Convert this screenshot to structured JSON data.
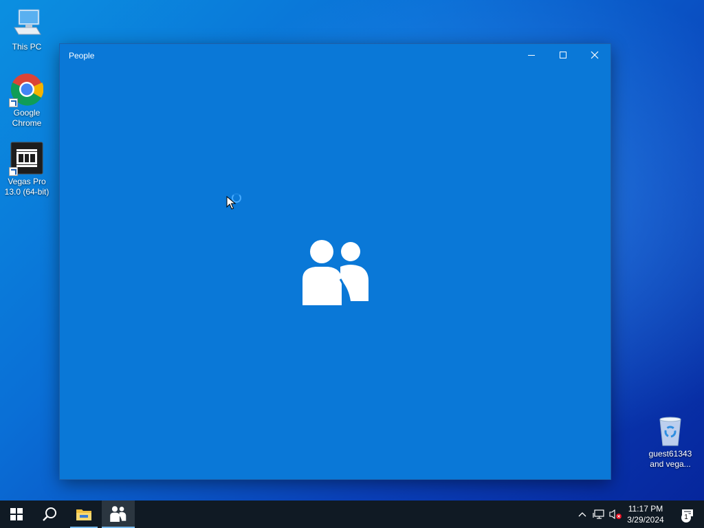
{
  "desktop": {
    "icons": [
      {
        "label": "This PC",
        "icon": "this-pc-icon"
      },
      {
        "label": "Google\nChrome",
        "icon": "chrome-icon"
      },
      {
        "label": "Vegas Pro\n13.0 (64-bit)",
        "icon": "vegas-pro-icon"
      },
      {
        "label": "guest61343\nand vega...",
        "icon": "recycle-bin-icon"
      }
    ]
  },
  "window": {
    "title": "People",
    "controls": [
      "minimize",
      "maximize",
      "close"
    ],
    "background": "#0a78d7",
    "splash_icon": "people-icon"
  },
  "taskbar": {
    "pinned": [
      {
        "name": "start",
        "icon": "windows-logo-icon"
      },
      {
        "name": "search",
        "icon": "search-icon"
      },
      {
        "name": "file-explorer",
        "icon": "folder-icon"
      },
      {
        "name": "people",
        "icon": "people-icon",
        "active": true
      }
    ],
    "tray": [
      "chevron-up-icon",
      "network-icon",
      "volume-muted-icon"
    ],
    "clock": {
      "time": "11:17 PM",
      "date": "3/29/2024"
    },
    "notifications": {
      "count": "1"
    }
  },
  "colors": {
    "accent": "#0a78d7",
    "taskbar": "#101a24",
    "highlight": "#76b9ed"
  }
}
